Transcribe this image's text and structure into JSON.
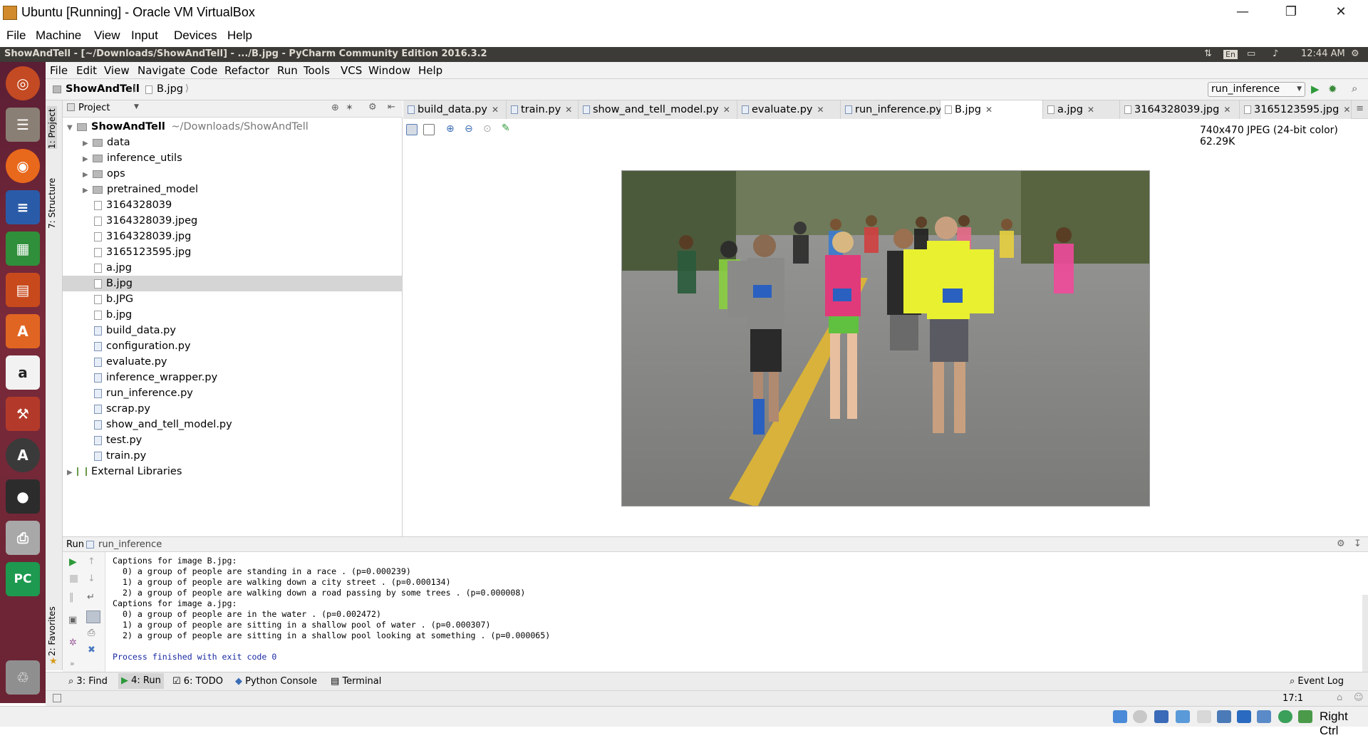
{
  "host": {
    "title": "Ubuntu [Running] - Oracle VM VirtualBox",
    "menu": [
      "File",
      "Machine",
      "View",
      "Input",
      "Devices",
      "Help"
    ],
    "right_ctrl": "Right Ctrl"
  },
  "ubuntu_panel": {
    "window_title": "ShowAndTell - [~/Downloads/ShowAndTell] - .../B.jpg - PyCharm Community Edition 2016.3.2",
    "lang": "En",
    "time": "12:44 AM"
  },
  "pycharm": {
    "menu": [
      "File",
      "Edit",
      "View",
      "Navigate",
      "Code",
      "Refactor",
      "Run",
      "Tools",
      "VCS",
      "Window",
      "Help"
    ],
    "breadcrumb": {
      "project": "ShowAndTell",
      "file": "B.jpg"
    },
    "run_config": "run_inference",
    "left_tabs": {
      "project": "1: Project",
      "structure": "7: Structure",
      "favorites": "2: Favorites"
    },
    "project_panel": {
      "header": "Project",
      "root": {
        "name": "ShowAndTell",
        "path": "~/Downloads/ShowAndTell"
      },
      "items": [
        {
          "name": "data",
          "kind": "folder"
        },
        {
          "name": "inference_utils",
          "kind": "folder"
        },
        {
          "name": "ops",
          "kind": "folder"
        },
        {
          "name": "pretrained_model",
          "kind": "folder"
        },
        {
          "name": "3164328039",
          "kind": "file"
        },
        {
          "name": "3164328039.jpeg",
          "kind": "image"
        },
        {
          "name": "3164328039.jpg",
          "kind": "image"
        },
        {
          "name": "3165123595.jpg",
          "kind": "image"
        },
        {
          "name": "a.jpg",
          "kind": "image"
        },
        {
          "name": "B.jpg",
          "kind": "image",
          "selected": true
        },
        {
          "name": "b.JPG",
          "kind": "image"
        },
        {
          "name": "b.jpg",
          "kind": "image"
        },
        {
          "name": "build_data.py",
          "kind": "py"
        },
        {
          "name": "configuration.py",
          "kind": "py"
        },
        {
          "name": "evaluate.py",
          "kind": "py"
        },
        {
          "name": "inference_wrapper.py",
          "kind": "py"
        },
        {
          "name": "run_inference.py",
          "kind": "py"
        },
        {
          "name": "scrap.py",
          "kind": "py"
        },
        {
          "name": "show_and_tell_model.py",
          "kind": "py"
        },
        {
          "name": "test.py",
          "kind": "py"
        },
        {
          "name": "train.py",
          "kind": "py"
        }
      ],
      "external": "External Libraries"
    },
    "editor_tabs": [
      {
        "label": "build_data.py",
        "kind": "py"
      },
      {
        "label": "train.py",
        "kind": "py"
      },
      {
        "label": "show_and_tell_model.py",
        "kind": "py"
      },
      {
        "label": "evaluate.py",
        "kind": "py"
      },
      {
        "label": "run_inference.py",
        "kind": "py"
      },
      {
        "label": "B.jpg",
        "kind": "image",
        "active": true
      },
      {
        "label": "a.jpg",
        "kind": "image"
      },
      {
        "label": "3164328039.jpg",
        "kind": "image"
      },
      {
        "label": "3165123595.jpg",
        "kind": "image"
      }
    ],
    "image_info": "740x470 JPEG (24-bit color) 62.29K",
    "run_panel": {
      "label": "Run",
      "config": "run_inference",
      "console_lines": [
        "Captions for image B.jpg:",
        "  0) a group of people are standing in a race . (p=0.000239)",
        "  1) a group of people are walking down a city street . (p=0.000134)",
        "  2) a group of people are walking down a road passing by some trees . (p=0.000008)",
        "Captions for image a.jpg:",
        "  0) a group of people are in the water . (p=0.002472)",
        "  1) a group of people are sitting in a shallow pool of water . (p=0.000307)",
        "  2) a group of people are sitting in a shallow pool looking at something . (p=0.000065)"
      ],
      "finish": "Process finished with exit code 0"
    },
    "bottom_tabs": [
      "3: Find",
      "4: Run",
      "6: TODO",
      "Python Console",
      "Terminal"
    ],
    "event_log": "Event Log",
    "cursor_pos": "17:1"
  }
}
